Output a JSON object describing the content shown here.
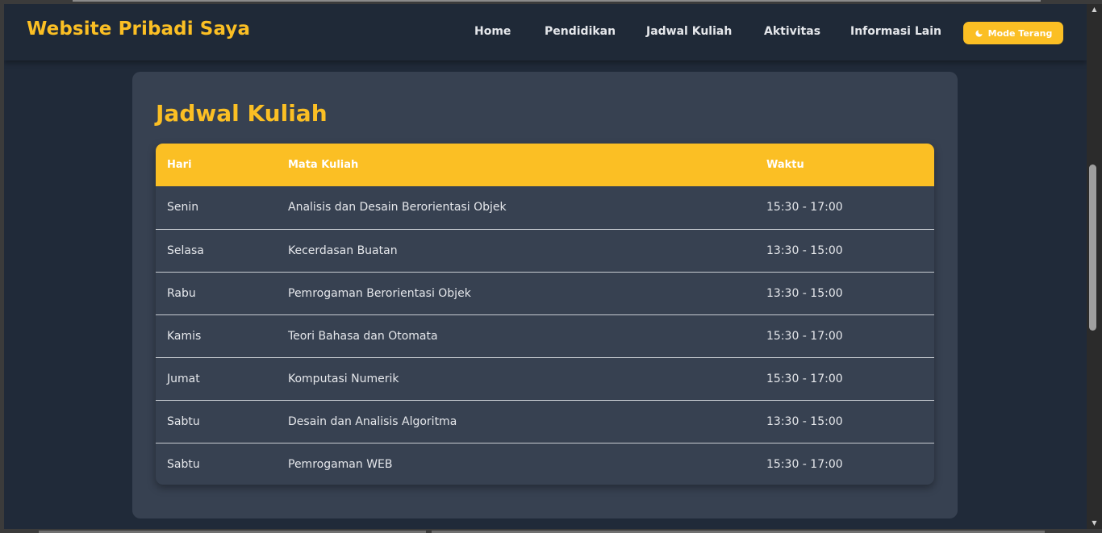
{
  "header": {
    "brand": "Website Pribadi Saya",
    "nav": [
      "Home",
      "Pendidikan",
      "Jadwal Kuliah",
      "Aktivitas",
      "Informasi Lain"
    ],
    "mode_button": "Mode Terang",
    "mode_icon": "moon-icon"
  },
  "section": {
    "title": "Jadwal Kuliah"
  },
  "table": {
    "headers": [
      "Hari",
      "Mata Kuliah",
      "Waktu"
    ],
    "rows": [
      [
        "Senin",
        "Analisis dan Desain Berorientasi Objek",
        "15:30 - 17:00"
      ],
      [
        "Selasa",
        "Kecerdasan Buatan",
        "13:30 - 15:00"
      ],
      [
        "Rabu",
        "Pemrogaman Berorientasi Objek",
        "13:30 - 15:00"
      ],
      [
        "Kamis",
        "Teori Bahasa dan Otomata",
        "15:30 - 17:00"
      ],
      [
        "Jumat",
        "Komputasi Numerik",
        "15:30 - 17:00"
      ],
      [
        "Sabtu",
        "Desain dan Analisis Algoritma",
        "13:30 - 15:00"
      ],
      [
        "Sabtu",
        "Pemrogaman WEB",
        "15:30 - 17:00"
      ]
    ]
  },
  "colors": {
    "accent": "#fbbf24",
    "header_bg": "#1f2937",
    "card_bg": "#374151",
    "page_bg": "#202a39"
  }
}
